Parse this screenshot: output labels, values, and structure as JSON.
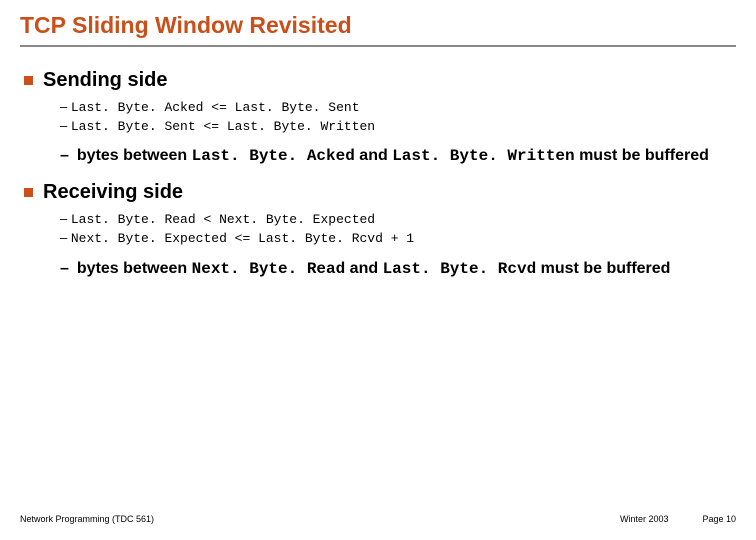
{
  "title": "TCP Sliding Window Revisited",
  "section1": {
    "heading": "Sending side",
    "rel1": "Last. Byte. Acked <= Last. Byte. Sent",
    "rel2": "Last. Byte. Sent <= Last. Byte. Written",
    "emph_pre": "bytes between ",
    "emph_code1": "Last. Byte. Acked",
    "emph_mid": " and ",
    "emph_code2": "Last. Byte. Written",
    "emph_post": " must be buffered"
  },
  "section2": {
    "heading": "Receiving side",
    "rel1": "Last. Byte. Read < Next. Byte. Expected",
    "rel2": "Next. Byte. Expected <= Last. Byte. Rcvd + 1",
    "emph_pre": "bytes between ",
    "emph_code1": "Next. Byte. Read",
    "emph_mid": " and ",
    "emph_code2": "Last. Byte. Rcvd",
    "emph_post": " must be buffered"
  },
  "footer": {
    "left": "Network Programming (TDC 561)",
    "mid": "Winter 2003",
    "right": "Page 10"
  }
}
